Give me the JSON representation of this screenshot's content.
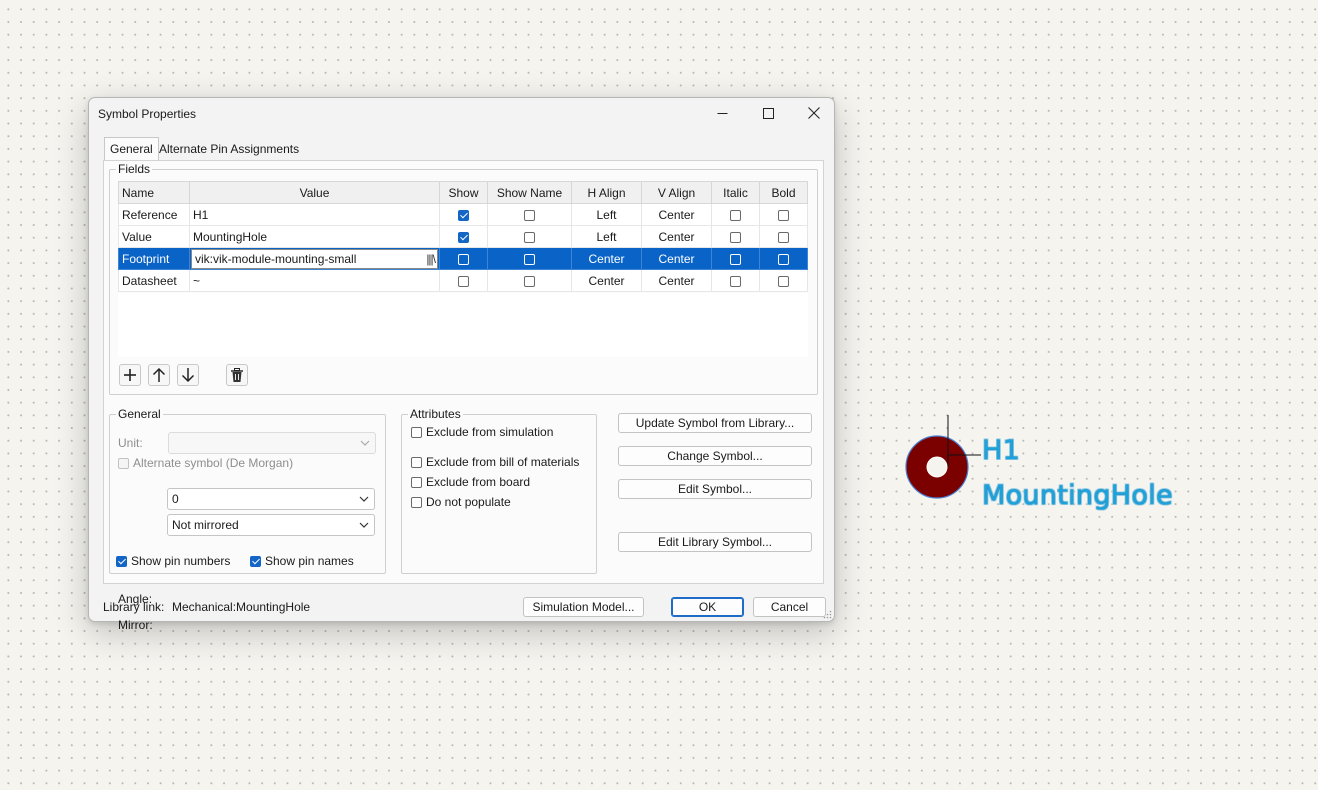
{
  "dialog": {
    "title": "Symbol Properties",
    "tabs": [
      "General",
      "Alternate Pin Assignments"
    ],
    "fields_group": "Fields",
    "columns": [
      "Name",
      "Value",
      "Show",
      "Show Name",
      "H Align",
      "V Align",
      "Italic",
      "Bold"
    ],
    "rows": [
      {
        "name": "Reference",
        "value": "H1",
        "show": true,
        "show_name": false,
        "h_align": "Left",
        "v_align": "Center",
        "italic": false,
        "bold": false
      },
      {
        "name": "Value",
        "value": "MountingHole",
        "show": true,
        "show_name": false,
        "h_align": "Left",
        "v_align": "Center",
        "italic": false,
        "bold": false
      },
      {
        "name": "Footprint",
        "value": "vik:vik-module-mounting-small",
        "show": false,
        "show_name": false,
        "h_align": "Center",
        "v_align": "Center",
        "italic": false,
        "bold": false
      },
      {
        "name": "Datasheet",
        "value": "~",
        "show": false,
        "show_name": false,
        "h_align": "Center",
        "v_align": "Center",
        "italic": false,
        "bold": false
      }
    ],
    "general": {
      "label": "General",
      "unit_label": "Unit:",
      "alternate_symbol": "Alternate symbol (De Morgan)",
      "angle_label": "Angle:",
      "angle_value": "0",
      "mirror_label": "Mirror:",
      "mirror_value": "Not mirrored",
      "show_pin_numbers": "Show pin numbers",
      "show_pin_names": "Show pin names"
    },
    "attributes": {
      "label": "Attributes",
      "exclude_sim": "Exclude from simulation",
      "exclude_bom": "Exclude from bill of materials",
      "exclude_board": "Exclude from board",
      "dnp": "Do not populate"
    },
    "actions": {
      "update": "Update Symbol from Library...",
      "change": "Change Symbol...",
      "edit": "Edit Symbol...",
      "edit_lib": "Edit Library Symbol..."
    },
    "library_link_label": "Library link:",
    "library_link_value": "Mechanical:MountingHole",
    "sim_model": "Simulation Model...",
    "ok": "OK",
    "cancel": "Cancel"
  },
  "schematic": {
    "reference": "H1",
    "value": "MountingHole",
    "colors": {
      "body": "#7b0000",
      "text": "#1aa3dd"
    }
  }
}
